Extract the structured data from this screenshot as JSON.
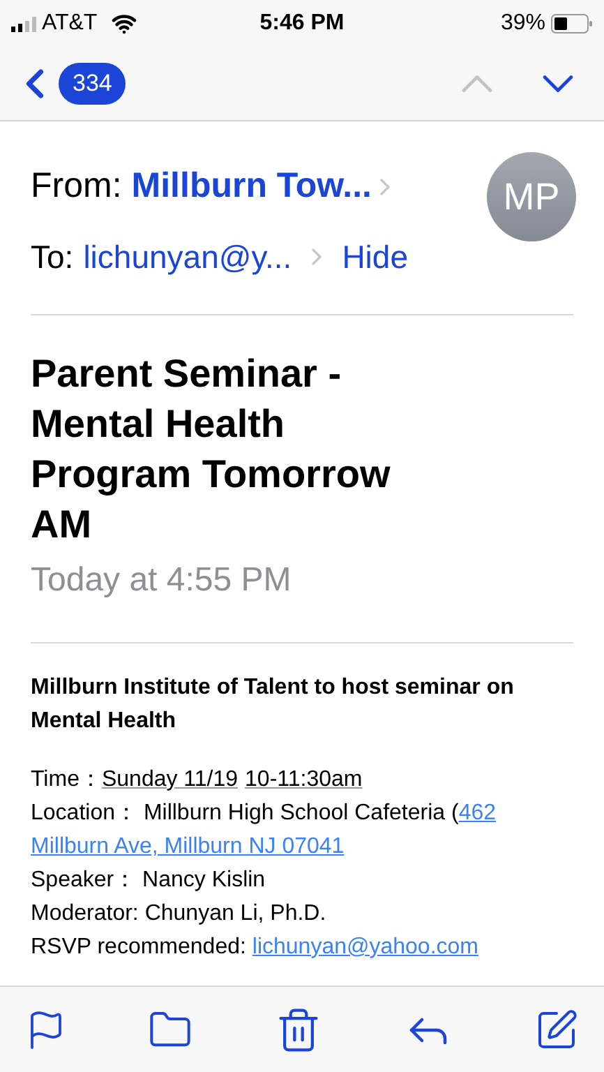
{
  "status_bar": {
    "carrier": "AT&T",
    "time": "5:46 PM",
    "battery": "39%"
  },
  "nav": {
    "count": "334",
    "prev_disabled": true,
    "next_disabled": false
  },
  "header": {
    "from_label": "From:",
    "from": "Millburn Tow...",
    "to_label": "To:",
    "to": "lichunyan@y...",
    "hide": "Hide",
    "avatar": "MP"
  },
  "subject": "Parent Seminar - Mental Health Program Tomorrow AM",
  "date": "Today at 4:55 PM",
  "body": {
    "heading": "Millburn Institute of Talent to host seminar on Mental Health",
    "lines": [
      [
        {
          "kind": "text",
          "text": "Time："
        },
        {
          "kind": "detected",
          "text": "Sunday 11/19"
        },
        {
          "kind": "detected",
          "text": "10-11:30am"
        }
      ],
      [
        {
          "kind": "text",
          "text": "Location： Millburn High School Cafeteria ("
        },
        {
          "kind": "link",
          "text": "462"
        },
        {
          "kind": "link",
          "text": "Millburn Ave, Millburn NJ 07041"
        }
      ],
      [
        {
          "kind": "text",
          "text": "Speaker： Nancy Kislin"
        }
      ],
      [
        {
          "kind": "text",
          "text": "Moderator: Chunyan Li, Ph.D."
        }
      ],
      [
        {
          "kind": "text",
          "text": "RSVP recommended: "
        },
        {
          "kind": "link",
          "text": "lichunyan@yahoo.com"
        }
      ]
    ]
  }
}
